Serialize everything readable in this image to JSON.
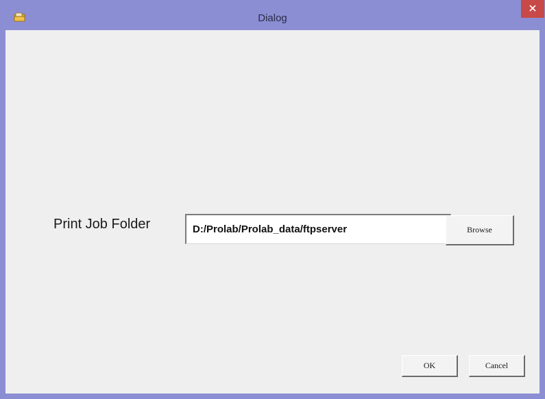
{
  "window": {
    "title": "Dialog",
    "close_symbol": "×"
  },
  "icons": {
    "app": "folder-app-icon",
    "close": "close-icon"
  },
  "form": {
    "folder_label": "Print Job Folder",
    "folder_path": "D:/Prolab/Prolab_data/ftpserver",
    "browse_label": "Browse"
  },
  "footer": {
    "ok_label": "OK",
    "cancel_label": "Cancel"
  },
  "colors": {
    "titlebar": "#8c8ed3",
    "close_button": "#c74a48",
    "client_background": "#efefef"
  }
}
